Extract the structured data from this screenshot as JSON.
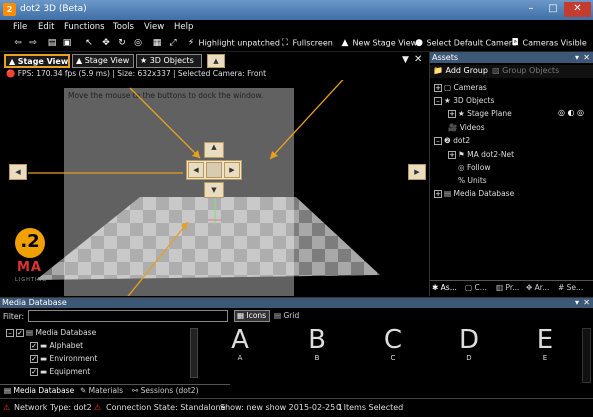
{
  "window": {
    "title": "dot2 3D (Beta)"
  },
  "menu": [
    "File",
    "Edit",
    "Functions",
    "Tools",
    "View",
    "Help"
  ],
  "toolbar": {
    "highlight": "Highlight unpatched",
    "fullscreen": "Fullscreen",
    "new_stage_view": "New Stage View",
    "select_default_camera": "Select Default Camera",
    "cameras_visible": "Cameras Visible"
  },
  "view_tabs": [
    "Stage View",
    "Stage View",
    "3D Objects"
  ],
  "info_line": "FPS: 170.34 fps (5.9 ms) | Size: 632x337 | Selected Camera: Front",
  "dock_hint": "Move the mouse to the buttons to dock the window.",
  "brand": {
    "logo_num": ".2",
    "logo_letters": "MA",
    "logo_sub": "LIGHTING"
  },
  "assets": {
    "title": "Assets",
    "add_group": "Add Group",
    "group_objects": "Group Objects",
    "tree": [
      "Cameras",
      "3D Objects",
      "Stage Plane",
      "Videos",
      "dot2",
      "MA dot2-Net",
      "Follow",
      "Units",
      "Media Database"
    ],
    "bottom_tabs": [
      "As...",
      "C...",
      "Pr...",
      "Ar...",
      "Se..."
    ]
  },
  "media": {
    "title": "Media Database",
    "filter_label": "Filter:",
    "view_icons": "Icons",
    "view_grid": "Grid",
    "tree": [
      "Media Database",
      "Alphabet",
      "Environment",
      "Equipment"
    ],
    "letters": [
      "A",
      "B",
      "C",
      "D",
      "E"
    ],
    "tabs": [
      "Media Database",
      "Materials",
      "Sessions (dot2)"
    ]
  },
  "status": {
    "network_type": "Network Type: dot2",
    "connection": "Connection State: Standalone",
    "show": "Show: new show 2015-02-25 1",
    "selected": "0 Items Selected"
  },
  "colors": {
    "accent": "#e8a020",
    "titlebar": "#4f7fb6",
    "panel_header": "#3d5877"
  }
}
